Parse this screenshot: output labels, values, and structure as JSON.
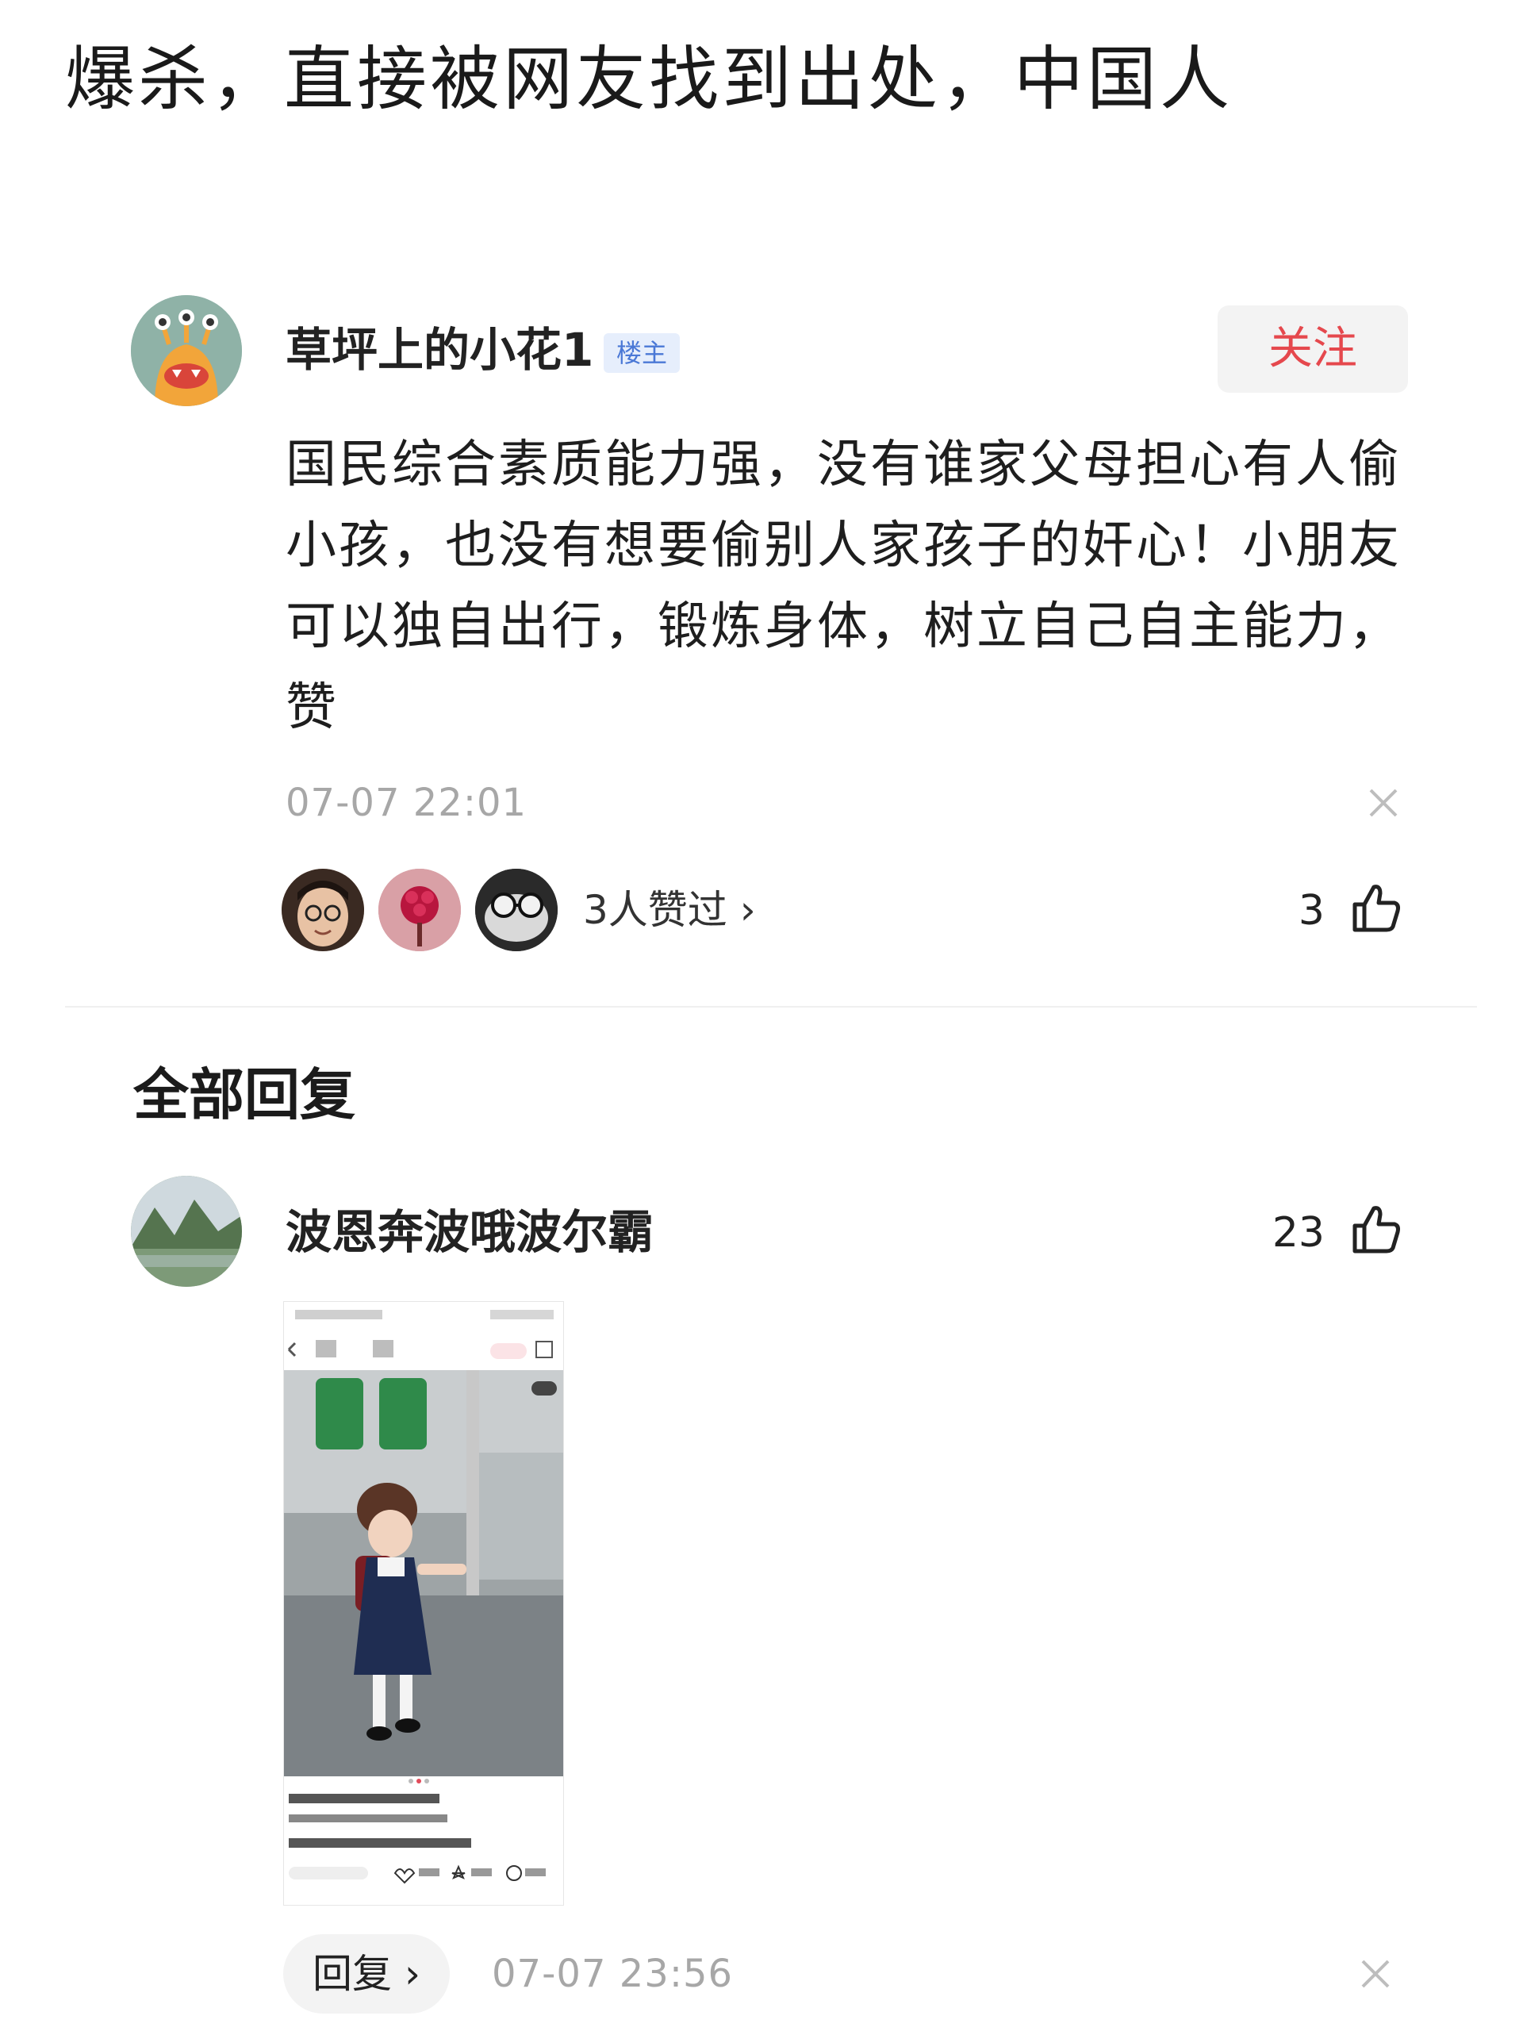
{
  "headline": "爆杀，直接被网友找到出处，中国人",
  "post": {
    "author": "草坪上的小花1",
    "badge": "楼主",
    "follow_label": "关注",
    "body": "国民综合素质能力强，没有谁家父母担心有人偷小孩，也没有想要偷别人家孩子的奸心！小朋友可以独自出行，锻炼身体，树立自己自主能力，赞",
    "timestamp": "07-07 22:01",
    "likers_text": "3人赞过 ›",
    "like_count": "3"
  },
  "replies_section": {
    "title": "全部回复"
  },
  "reply": {
    "author": "波恩奔波哦波尔霸",
    "like_count": "23",
    "reply_label": "回复 ›",
    "timestamp": "07-07 23:56"
  },
  "icons": {
    "close": "close-icon",
    "like": "thumbs-up-icon"
  },
  "colors": {
    "follow_text": "#e5484d",
    "badge_bg": "#e6eefc",
    "badge_text": "#4a78d6",
    "timestamp": "#a7a7a7"
  }
}
